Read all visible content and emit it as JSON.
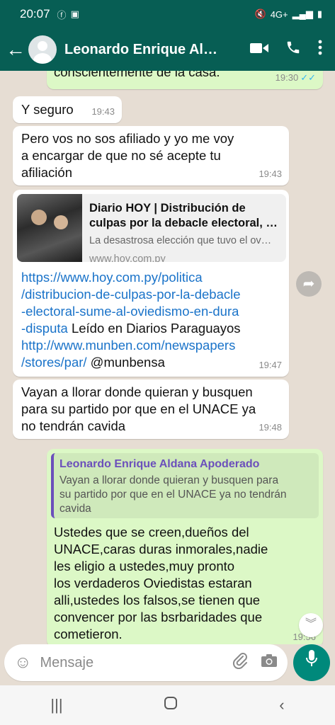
{
  "status_bar": {
    "time": "20:07",
    "network": "4G+"
  },
  "header": {
    "contact_name": "Leonardo Enrique Alda…"
  },
  "messages": {
    "m0": {
      "text": "conscientemente de la casa.",
      "time": "19:30",
      "ticks": "✓✓"
    },
    "m1": {
      "text": "Y seguro",
      "time": "19:43"
    },
    "m2": {
      "line1": "Pero vos no sos afiliado y yo me voy",
      "line2": "a encargar de que no sé acepte tu",
      "line3": "afiliación",
      "time": "19:43"
    },
    "m3": {
      "preview_title1": "Diario HOY | Distribución de",
      "preview_title2": "culpas por la debacle electoral, …",
      "preview_desc": "La desastrosa elección que tuvo el ov…",
      "preview_url": "www.hoy.com.py",
      "link1_l1": "https://www.hoy.com.py/politica",
      "link1_l2": "/distribucion-de-culpas-por-la-debacle",
      "link1_l3": "-electoral-sume-al-oviedismo-en-dura",
      "link1_l4": "-disputa",
      "text_after": " Leído en Diarios Paraguayos",
      "link2_l1": "http://www.munben.com/newspapers",
      "link2_l2": "/stores/par/",
      "mention": " @munbensa",
      "time": "19:47"
    },
    "m4": {
      "line1": "Vayan a llorar donde quieran y busquen",
      "line2": "para su partido por que en el UNACE ya",
      "line3": "no tendrán cavida",
      "time": "19:48"
    },
    "m5": {
      "quote_name": "Leonardo Enrique Aldana Apoderado",
      "quote_l1": "Vayan a llorar donde quieran y busquen para",
      "quote_l2": "su partido por que en el UNACE ya no tendrán",
      "quote_l3": "cavida",
      "line1": "Ustedes que se creen,dueños del",
      "line2": "UNACE,caras duras inmorales,nadie",
      "line3": "les eligio a ustedes,muy pronto",
      "line4": "los verdaderos Oviedistas estaran",
      "line5": "alli,ustedes los falsos,se tienen que",
      "line6": "convencer por las bsrbaridades que",
      "line7": "cometieron.",
      "time": "19:56"
    }
  },
  "composer": {
    "placeholder": "Mensaje"
  },
  "icons": {
    "back": "arrow-left-icon",
    "video": "video-camera-icon",
    "call": "phone-icon",
    "menu": "more-vert-icon",
    "emoji": "emoji-icon",
    "attach": "paperclip-icon",
    "camera": "camera-icon",
    "mic": "microphone-icon",
    "forward": "forward-icon"
  },
  "colors": {
    "header": "#075e54",
    "outgoing_bubble": "#dcf8c6",
    "incoming_bubble": "#ffffff",
    "link": "#1a73c9",
    "quote_accent": "#6b4fbb",
    "mic_button": "#00897b"
  }
}
